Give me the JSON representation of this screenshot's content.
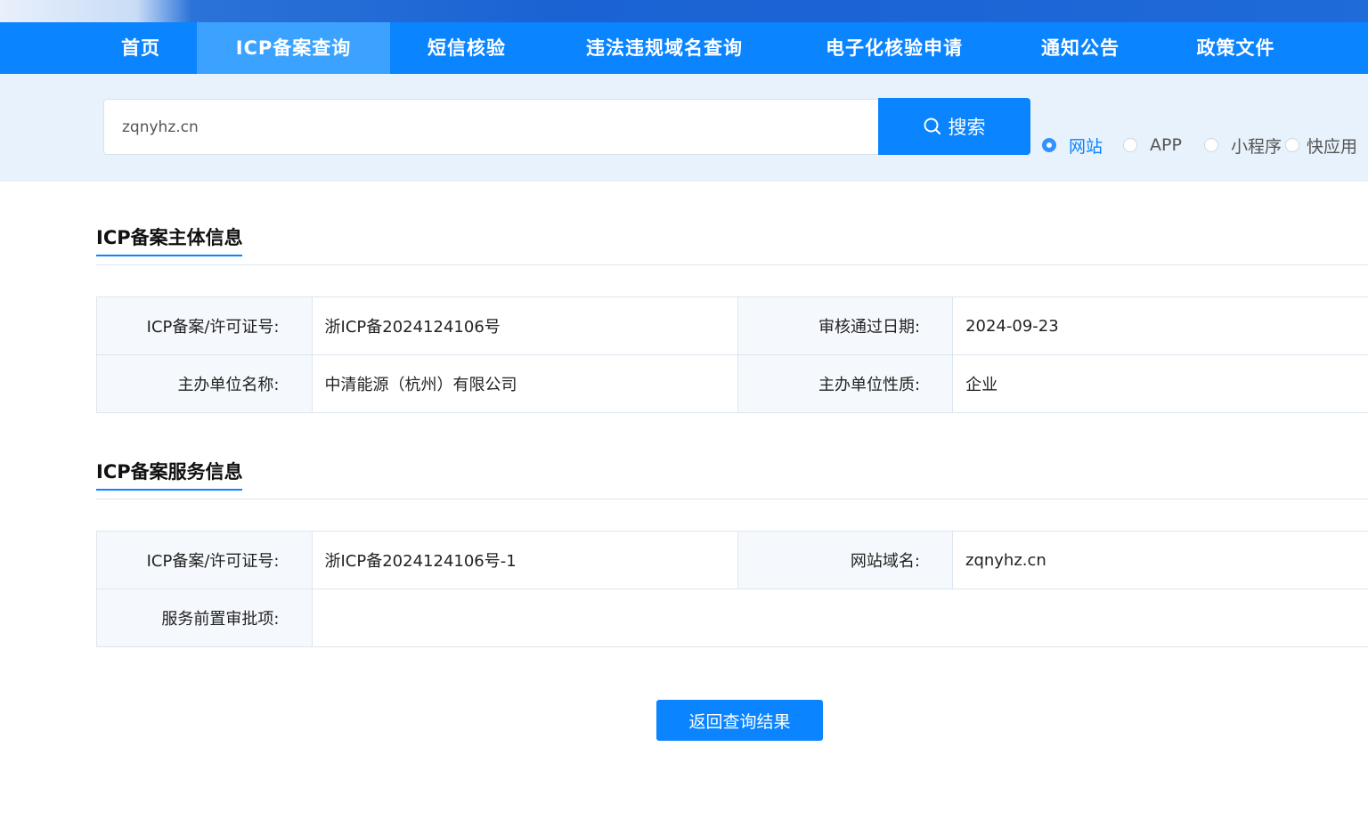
{
  "nav": {
    "items": [
      {
        "label": "首页"
      },
      {
        "label": "ICP备案查询"
      },
      {
        "label": "短信核验"
      },
      {
        "label": "违法违规域名查询"
      },
      {
        "label": "电子化核验申请"
      },
      {
        "label": "通知公告"
      },
      {
        "label": "政策文件"
      }
    ],
    "active_index": 1
  },
  "search": {
    "value": "zqnyhz.cn",
    "button_label": "搜索",
    "button_icon": "search-icon",
    "types": [
      {
        "label": "网站",
        "checked": true
      },
      {
        "label": "APP",
        "checked": false
      },
      {
        "label": "小程序",
        "checked": false
      },
      {
        "label": "快应用",
        "checked": false
      }
    ]
  },
  "subject_section": {
    "title": "ICP备案主体信息",
    "rows": [
      {
        "label1": "ICP备案/许可证号:",
        "value1": "浙ICP备2024124106号",
        "label2": "审核通过日期:",
        "value2": "2024-09-23"
      },
      {
        "label1": "主办单位名称:",
        "value1": "中清能源（杭州）有限公司",
        "label2": "主办单位性质:",
        "value2": "企业"
      }
    ]
  },
  "service_section": {
    "title": "ICP备案服务信息",
    "rows": [
      {
        "label1": "ICP备案/许可证号:",
        "value1": "浙ICP备2024124106号-1",
        "label2": "网站域名:",
        "value2": "zqnyhz.cn"
      },
      {
        "label1": "服务前置审批项:",
        "value1": ""
      }
    ]
  },
  "back_button_label": "返回查询结果",
  "colors": {
    "primary": "#0a84ff",
    "nav_active": "#3ba3ff",
    "search_band": "#e8f2fc",
    "label_bg": "#f5f9fd"
  }
}
